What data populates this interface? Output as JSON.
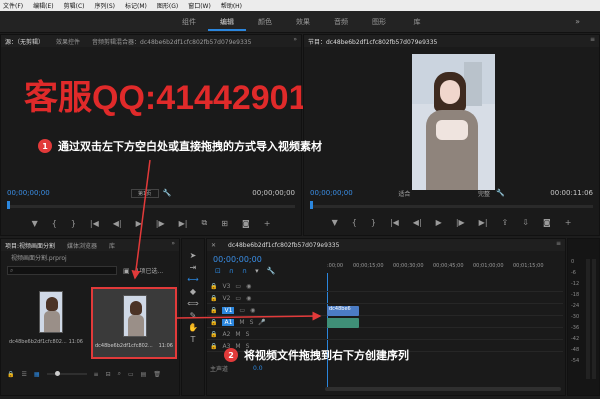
{
  "menu": [
    "文件(F)",
    "编辑(E)",
    "剪辑(C)",
    "序列(S)",
    "标记(M)",
    "图形(G)",
    "窗口(W)",
    "帮助(H)"
  ],
  "workspace": {
    "tabs": [
      "组件",
      "编辑",
      "颜色",
      "效果",
      "音频",
      "图形",
      "库"
    ],
    "active": "编辑",
    "more": "»"
  },
  "source_panel": {
    "tabs": [
      "源：（无剪辑）",
      "效果控件",
      "音频剪辑混合器：dc48be6b2df1cfc802fb57d079e9335"
    ],
    "timecode_left": "00;00;00;00",
    "page": "第1页",
    "timecode_right": "00;00;00;00"
  },
  "program_panel": {
    "title": "节目：dc48be6b2df1cfc802fb57d079e9335",
    "timecode_left": "00;00;00;00",
    "fit": "适合",
    "quality": "完整",
    "timecode_right": "00:00:11:06"
  },
  "watermark": "客服QQ:41442901",
  "callout1": {
    "num": "1",
    "text": "通过双击左下方空白处或直接拖拽的方式导入视频素材"
  },
  "callout2": {
    "num": "2",
    "text": "将视频文件拖拽到右下方创建序列"
  },
  "project_panel": {
    "tabs": [
      "项目:视频画面分割",
      "媒体浏览器",
      "库"
    ],
    "filename": "视频画面分割.prproj",
    "selected": "1项已选...",
    "clip1": {
      "name": "dc48be6b2df1cfc802...",
      "duration": "11:06"
    },
    "clip2": {
      "name": "dc48be6b2df1cfc802...",
      "duration": "11:06"
    }
  },
  "timeline": {
    "title": "dc48be6b2df1cfc802fb57d079e9335",
    "timecode": "00;00;00;00",
    "ruler": [
      ":00;00",
      "00;00;15;00",
      "00;00;30;00",
      "00;00;45;00",
      "00;01;00;00",
      "00;01;15;00"
    ],
    "tracks": [
      "V3",
      "V2",
      "V1",
      "A1",
      "A2",
      "A3"
    ],
    "v1_clip": "dc48be6",
    "master": "主声道",
    "master_val": "0.0"
  },
  "meter_scale": [
    "0",
    "-6",
    "-12",
    "-18",
    "-24",
    "-30",
    "-36",
    "-42",
    "-48",
    "-54"
  ],
  "colors": {
    "accent_blue": "#2b86dd",
    "callout_red": "#e23a3a",
    "v1_clip": "#4b7cc4",
    "a1_clip": "#3f8f77"
  }
}
